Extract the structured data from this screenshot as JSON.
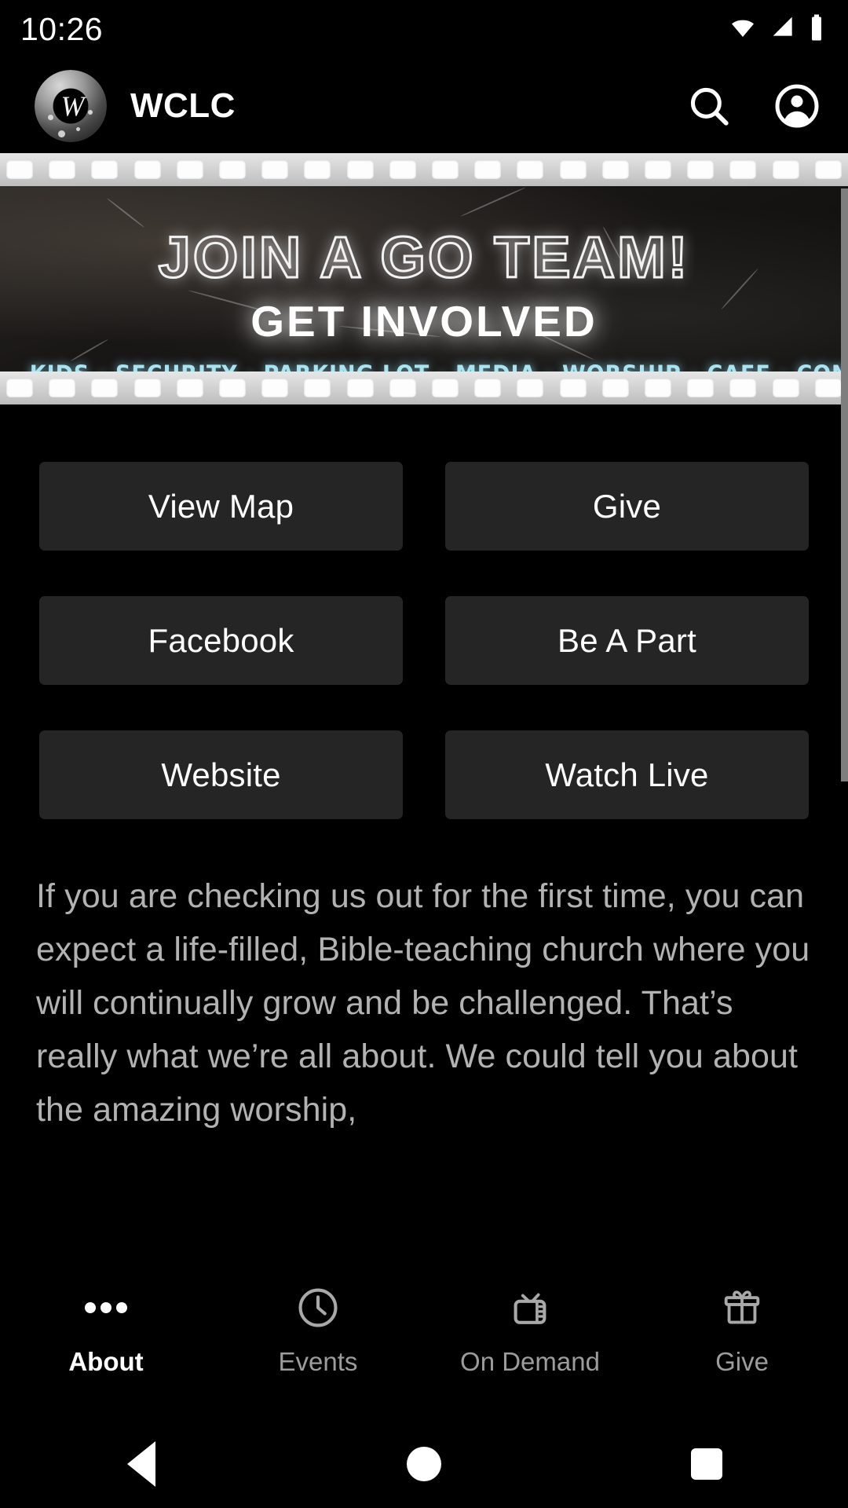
{
  "status_bar": {
    "time": "10:26",
    "icons": [
      "wifi-icon",
      "cellular-signal-icon",
      "battery-icon"
    ]
  },
  "app_bar": {
    "title": "WCLC",
    "logo_monogram": "W",
    "actions": [
      {
        "name": "search-icon",
        "label": "Search"
      },
      {
        "name": "account-circle-icon",
        "label": "Account"
      }
    ]
  },
  "banner": {
    "line1": "JOIN A GO TEAM!",
    "line2": "GET INVOLVED",
    "teams": "KIDS - SECURITY - PARKING LOT - MEDIA - WORSHIP - CAFE - CONNECT CENTER - PRAYER TEAM",
    "teams_color": "#a8e4ef"
  },
  "tiles": [
    {
      "label": "View Map"
    },
    {
      "label": "Give"
    },
    {
      "label": "Facebook"
    },
    {
      "label": "Be A Part"
    },
    {
      "label": "Website"
    },
    {
      "label": "Watch Live"
    }
  ],
  "about": {
    "paragraph": "If you are checking us out for the first time, you can expect a life-filled, Bible-teaching church where you will continually grow and be challenged. That’s really what we’re all about. We could tell you about the amazing worship,"
  },
  "bottom_nav": {
    "items": [
      {
        "label": "About",
        "icon": "more-horizontal-icon",
        "active": true
      },
      {
        "label": "Events",
        "icon": "clock-icon",
        "active": false
      },
      {
        "label": "On Demand",
        "icon": "tv-icon",
        "active": false
      },
      {
        "label": "Give",
        "icon": "gift-icon",
        "active": false
      }
    ]
  },
  "android_nav": {
    "back": "back-triangle-icon",
    "home": "home-circle-icon",
    "recents": "recents-square-icon"
  },
  "colors": {
    "background": "#000000",
    "tile": "#252525",
    "body_text": "#b2b2b2",
    "scrollbar": "#7e7e7e"
  }
}
